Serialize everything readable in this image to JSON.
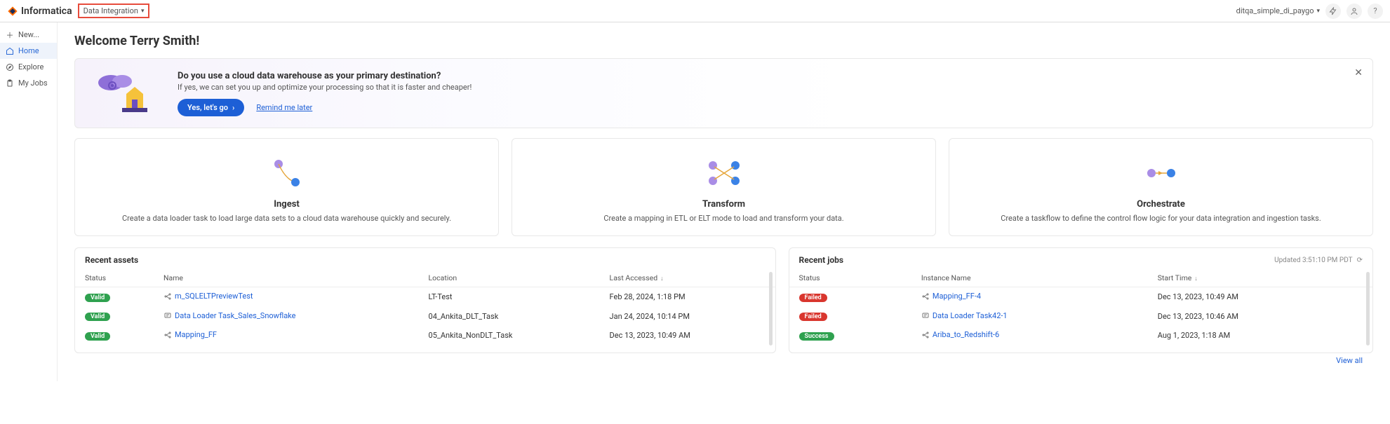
{
  "topbar": {
    "brand": "Informatica",
    "service": "Data Integration",
    "org": "ditqa_simple_di_paygo"
  },
  "sidebar": {
    "items": [
      {
        "label": "New...",
        "icon": "plus"
      },
      {
        "label": "Home",
        "icon": "home",
        "active": true
      },
      {
        "label": "Explore",
        "icon": "compass"
      },
      {
        "label": "My Jobs",
        "icon": "clipboard"
      }
    ]
  },
  "welcome": "Welcome Terry Smith!",
  "banner": {
    "title": "Do you use a cloud data warehouse as your primary destination?",
    "subtitle": "If yes, we can set you up and optimize your processing so that it is faster and cheaper!",
    "cta": "Yes, let's go",
    "remind": "Remind me later"
  },
  "cards": [
    {
      "title": "Ingest",
      "desc": "Create a data loader task to load large data sets to a cloud data warehouse quickly and securely."
    },
    {
      "title": "Transform",
      "desc": "Create a mapping in ETL or ELT mode to load and transform your data."
    },
    {
      "title": "Orchestrate",
      "desc": "Create a taskflow to define the control flow logic for your data integration and ingestion tasks."
    }
  ],
  "assets": {
    "title": "Recent assets",
    "cols": {
      "status": "Status",
      "name": "Name",
      "location": "Location",
      "last": "Last Accessed"
    },
    "rows": [
      {
        "status": "Valid",
        "statusClass": "valid",
        "name": "m_SQLELTPreviewTest",
        "icon": "mapping",
        "location": "LT-Test",
        "last": "Feb 28, 2024, 1:18 PM"
      },
      {
        "status": "Valid",
        "statusClass": "valid",
        "name": "Data Loader Task_Sales_Snowflake",
        "icon": "loader",
        "location": "04_Ankita_DLT_Task",
        "last": "Jan 24, 2024, 10:14 PM"
      },
      {
        "status": "Valid",
        "statusClass": "valid",
        "name": "Mapping_FF",
        "icon": "mapping",
        "location": "05_Ankita_NonDLT_Task",
        "last": "Dec 13, 2023, 10:49 AM"
      }
    ]
  },
  "jobs": {
    "title": "Recent jobs",
    "updated": "Updated 3:51:10 PM PDT",
    "cols": {
      "status": "Status",
      "instance": "Instance Name",
      "start": "Start Time"
    },
    "rows": [
      {
        "status": "Failed",
        "statusClass": "failed",
        "name": "Mapping_FF-4",
        "icon": "mapping",
        "start": "Dec 13, 2023, 10:49 AM"
      },
      {
        "status": "Failed",
        "statusClass": "failed",
        "name": "Data Loader Task42-1",
        "icon": "loader",
        "start": "Dec 13, 2023, 10:46 AM"
      },
      {
        "status": "Success",
        "statusClass": "success",
        "name": "Ariba_to_Redshift-6",
        "icon": "mapping",
        "start": "Aug 1, 2023, 1:18 AM"
      }
    ],
    "viewAll": "View all"
  }
}
